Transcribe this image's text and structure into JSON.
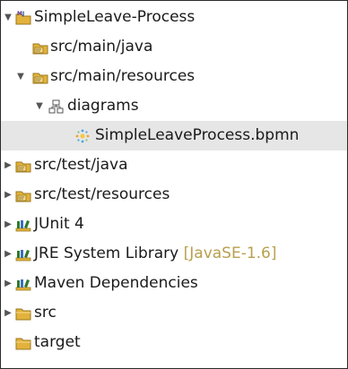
{
  "tree": {
    "items": [
      {
        "label": "SimpleLeave-Process",
        "icon": "maven-project-icon",
        "expanded": true
      },
      {
        "label": "src/main/java",
        "icon": "source-folder-icon"
      },
      {
        "label": "src/main/resources",
        "icon": "source-folder-icon",
        "expanded": true
      },
      {
        "label": "diagrams",
        "icon": "package-icon",
        "expanded": true
      },
      {
        "label": "SimpleLeaveProcess.bpmn",
        "icon": "bpmn-file-icon",
        "selected": true
      },
      {
        "label": "src/test/java",
        "icon": "source-folder-icon",
        "expanded": false
      },
      {
        "label": "src/test/resources",
        "icon": "source-folder-icon",
        "expanded": false
      },
      {
        "label": "JUnit 4",
        "icon": "library-icon",
        "expanded": false
      },
      {
        "label": "JRE System Library",
        "decoration": "[JavaSE-1.6]",
        "icon": "library-icon",
        "expanded": false
      },
      {
        "label": "Maven Dependencies",
        "icon": "library-icon",
        "expanded": false
      },
      {
        "label": "src",
        "icon": "folder-icon",
        "expanded": false
      },
      {
        "label": "target",
        "icon": "folder-icon"
      }
    ]
  },
  "colors": {
    "selection": "#e6e6e6",
    "decoration": "#b8a04d",
    "folder": "#e3b23c",
    "library": "#2f7a2f"
  }
}
